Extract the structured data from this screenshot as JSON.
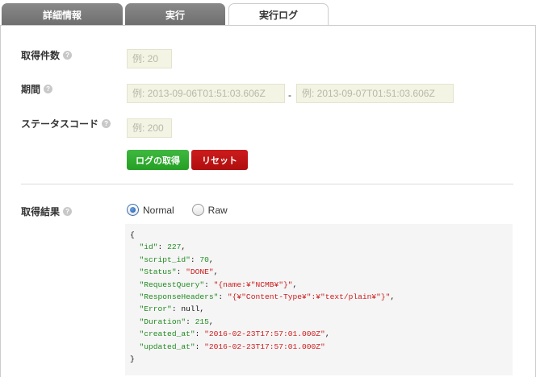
{
  "tabs": [
    {
      "label": "詳細情報",
      "active": false
    },
    {
      "label": "実行",
      "active": false
    },
    {
      "label": "実行ログ",
      "active": true
    }
  ],
  "form": {
    "count": {
      "label": "取得件数",
      "placeholder": "例: 20"
    },
    "period": {
      "label": "期間",
      "from_placeholder": "例: 2013-09-06T01:51:03.606Z",
      "separator": "-",
      "to_placeholder": "例: 2013-09-07T01:51:03.606Z"
    },
    "status_code": {
      "label": "ステータスコード",
      "placeholder": "例: 200"
    },
    "fetch_button": "ログの取得",
    "reset_button": "リセット",
    "help_glyph": "?"
  },
  "results": {
    "label": "取得結果",
    "format_options": [
      {
        "label": "Normal",
        "checked": true
      },
      {
        "label": "Raw",
        "checked": false
      }
    ],
    "json_open": "{",
    "json_close": "}",
    "fields": [
      {
        "key": "\"id\"",
        "value": "227",
        "type": "number",
        "comma": ","
      },
      {
        "key": "\"script_id\"",
        "value": "70",
        "type": "number",
        "comma": ","
      },
      {
        "key": "\"Status\"",
        "value": "\"DONE\"",
        "type": "string",
        "comma": ","
      },
      {
        "key": "\"RequestQuery\"",
        "value": "\"{name:¥\"NCMB¥\"}\"",
        "type": "string",
        "comma": ","
      },
      {
        "key": "\"ResponseHeaders\"",
        "value": "\"{¥\"Content-Type¥\":¥\"text/plain¥\"}\"",
        "type": "string",
        "comma": ","
      },
      {
        "key": "\"Error\"",
        "value": "null",
        "type": "plain",
        "comma": ","
      },
      {
        "key": "\"Duration\"",
        "value": "215",
        "type": "number",
        "comma": ","
      },
      {
        "key": "\"created_at\"",
        "value": "\"2016-02-23T17:57:01.000Z\"",
        "type": "string",
        "comma": ","
      },
      {
        "key": "\"updated_at\"",
        "value": "\"2016-02-23T17:57:01.000Z\"",
        "type": "string",
        "comma": ""
      }
    ]
  }
}
